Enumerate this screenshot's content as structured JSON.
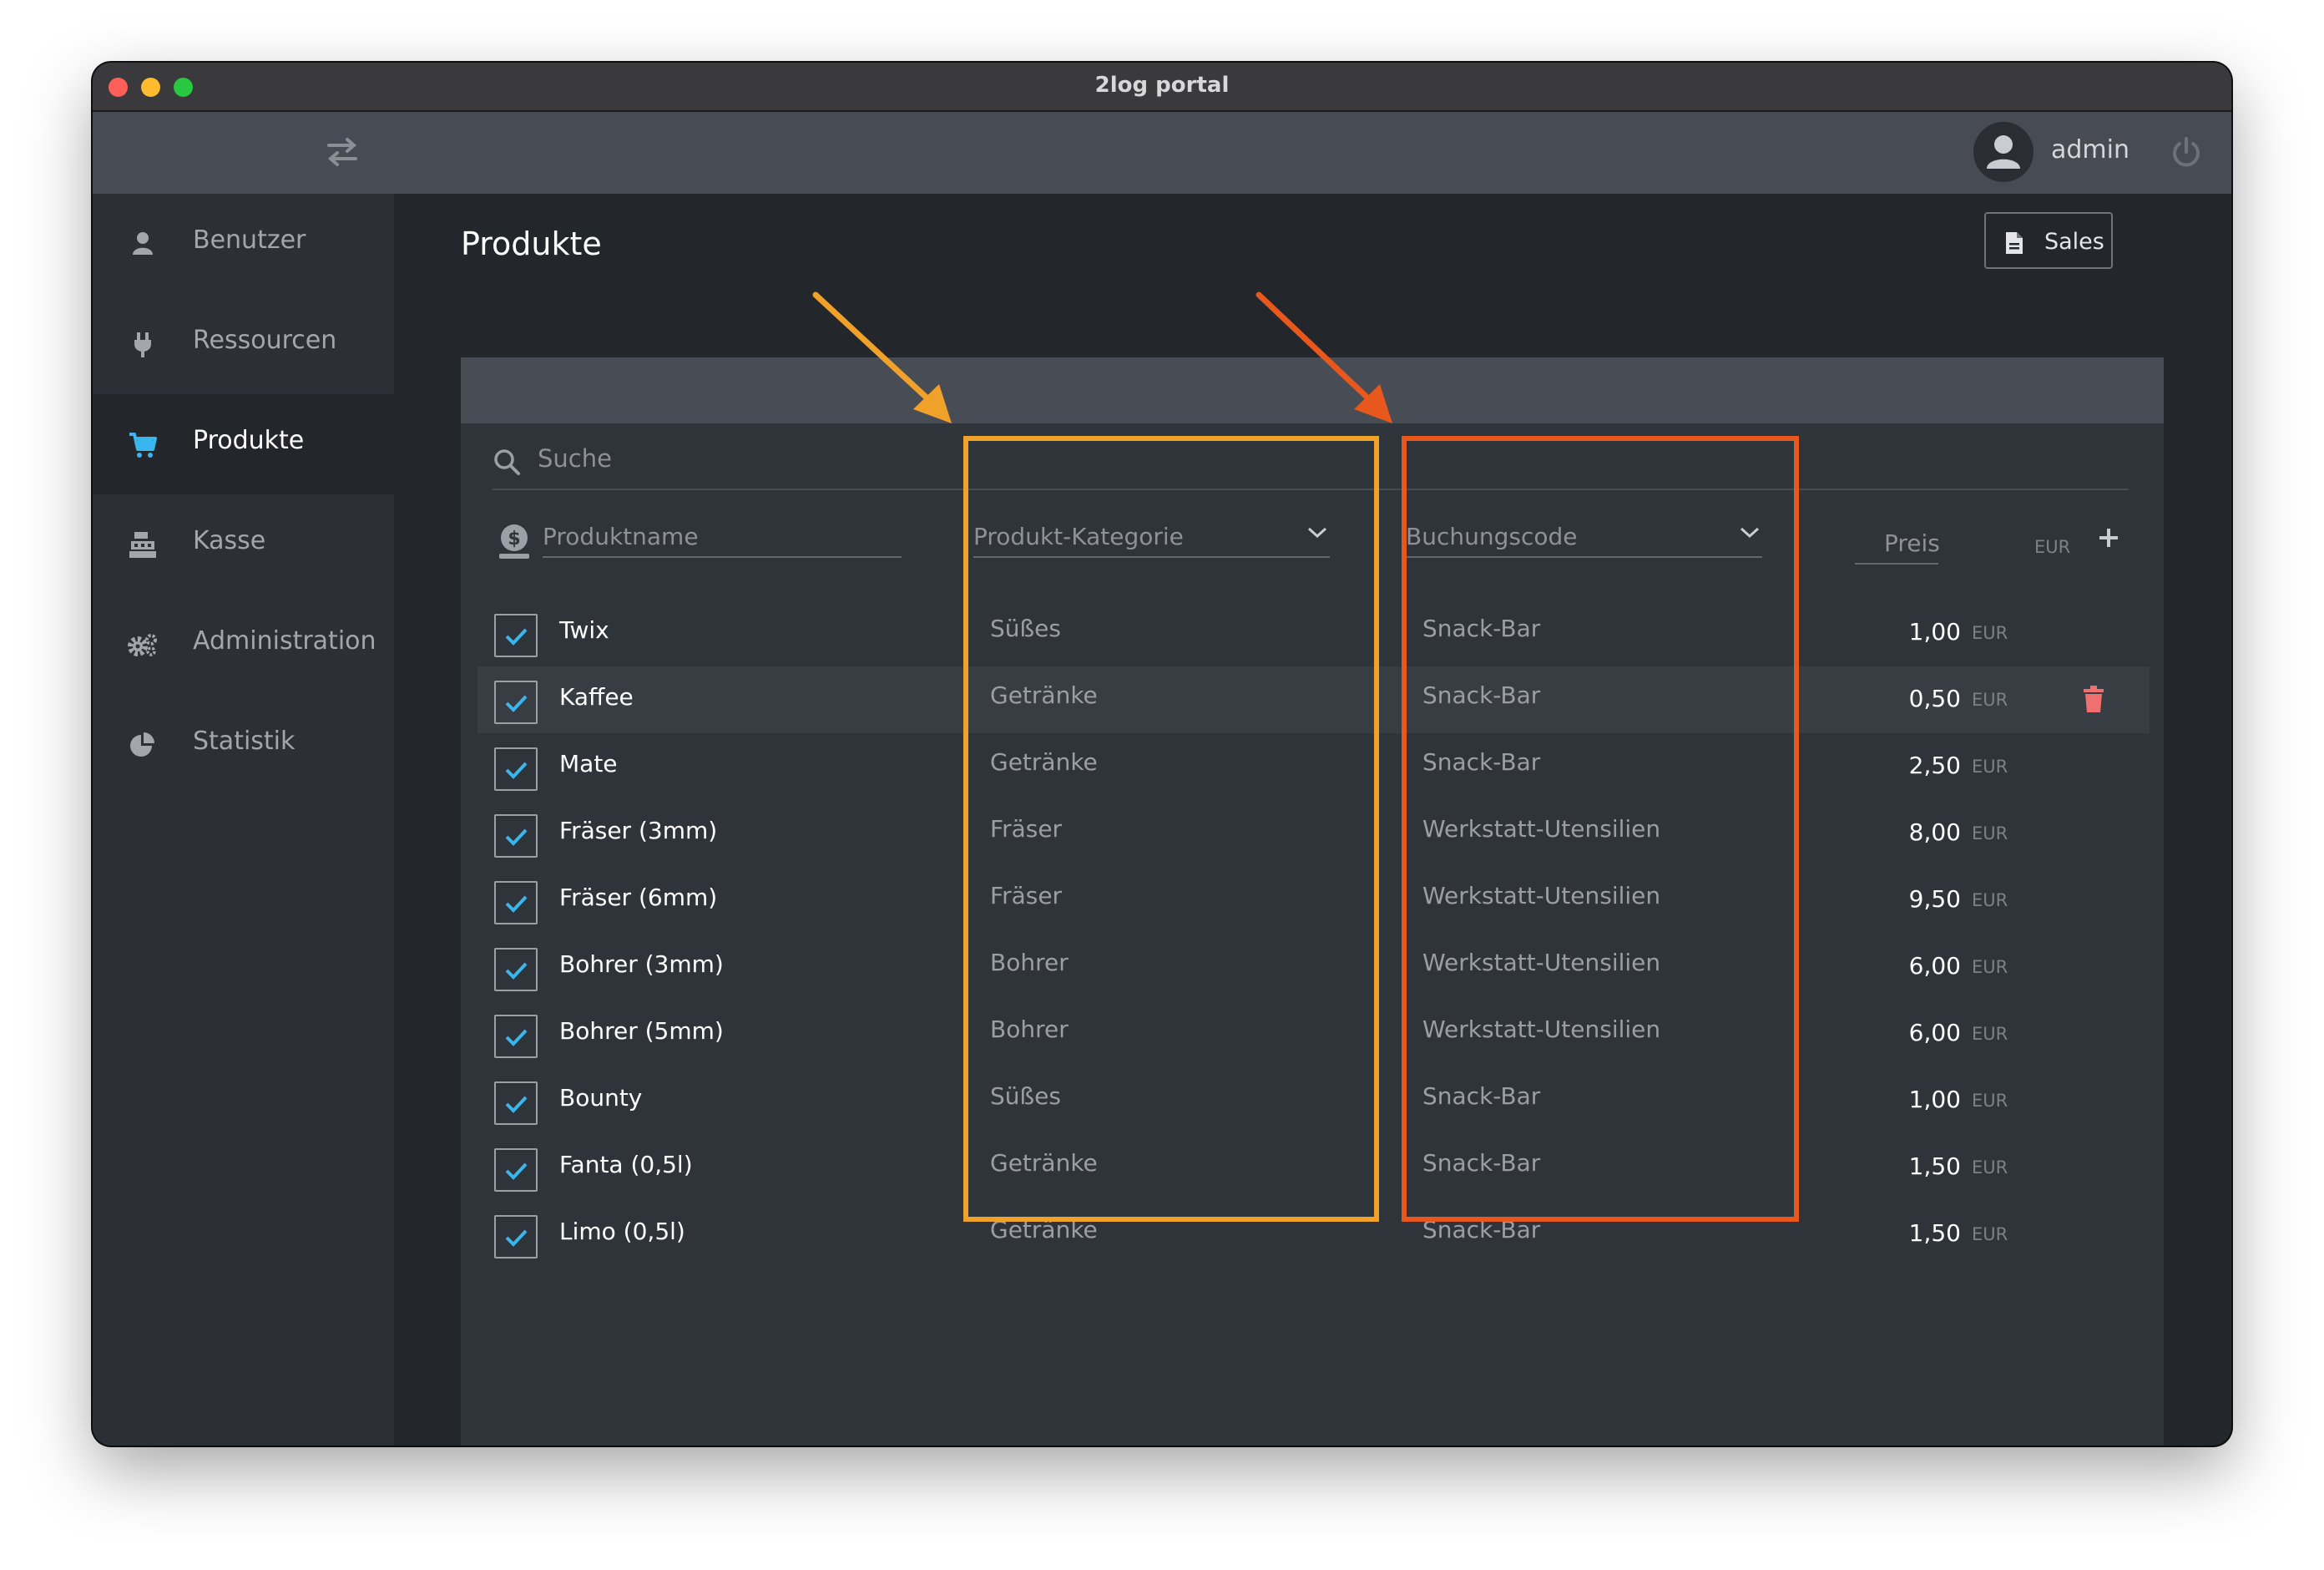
{
  "window": {
    "title": "2log portal"
  },
  "topbar": {
    "username": "admin"
  },
  "sidebar": {
    "items": [
      {
        "label": "Benutzer",
        "icon": "user-icon",
        "active": false
      },
      {
        "label": "Ressourcen",
        "icon": "plug-icon",
        "active": false
      },
      {
        "label": "Produkte",
        "icon": "cart-icon",
        "active": true
      },
      {
        "label": "Kasse",
        "icon": "register-icon",
        "active": false
      },
      {
        "label": "Administration",
        "icon": "gears-icon",
        "active": false
      },
      {
        "label": "Statistik",
        "icon": "pie-chart-icon",
        "active": false
      }
    ]
  },
  "main": {
    "title": "Produkte",
    "sales_button": "Sales",
    "search_placeholder": "Suche",
    "new_row": {
      "name_placeholder": "Produktname",
      "category_placeholder": "Produkt-Kategorie",
      "code_placeholder": "Buchungscode",
      "price_placeholder": "Preis",
      "currency": "EUR"
    },
    "products": [
      {
        "checked": true,
        "name": "Twix",
        "category": "Süßes",
        "code": "Snack-Bar",
        "price": "1,00",
        "currency": "EUR"
      },
      {
        "checked": true,
        "name": "Kaffee",
        "category": "Getränke",
        "code": "Snack-Bar",
        "price": "0,50",
        "currency": "EUR",
        "hovered": true
      },
      {
        "checked": true,
        "name": "Mate",
        "category": "Getränke",
        "code": "Snack-Bar",
        "price": "2,50",
        "currency": "EUR"
      },
      {
        "checked": true,
        "name": "Fräser (3mm)",
        "category": "Fräser",
        "code": "Werkstatt-Utensilien",
        "price": "8,00",
        "currency": "EUR"
      },
      {
        "checked": true,
        "name": "Fräser (6mm)",
        "category": "Fräser",
        "code": "Werkstatt-Utensilien",
        "price": "9,50",
        "currency": "EUR"
      },
      {
        "checked": true,
        "name": "Bohrer (3mm)",
        "category": "Bohrer",
        "code": "Werkstatt-Utensilien",
        "price": "6,00",
        "currency": "EUR"
      },
      {
        "checked": true,
        "name": "Bohrer (5mm)",
        "category": "Bohrer",
        "code": "Werkstatt-Utensilien",
        "price": "6,00",
        "currency": "EUR"
      },
      {
        "checked": true,
        "name": "Bounty",
        "category": "Süßes",
        "code": "Snack-Bar",
        "price": "1,00",
        "currency": "EUR"
      },
      {
        "checked": true,
        "name": "Fanta (0,5l)",
        "category": "Getränke",
        "code": "Snack-Bar",
        "price": "1,50",
        "currency": "EUR"
      },
      {
        "checked": true,
        "name": "Limo (0,5l)",
        "category": "Getränke",
        "code": "Snack-Bar",
        "price": "1,50",
        "currency": "EUR"
      }
    ]
  },
  "colors": {
    "checkbox_check": "#39b6f0",
    "active_nav_icon": "#39b6f0",
    "delete_icon": "#f07070",
    "annotation_category": "#f0a12a",
    "annotation_code": "#e8581d"
  }
}
